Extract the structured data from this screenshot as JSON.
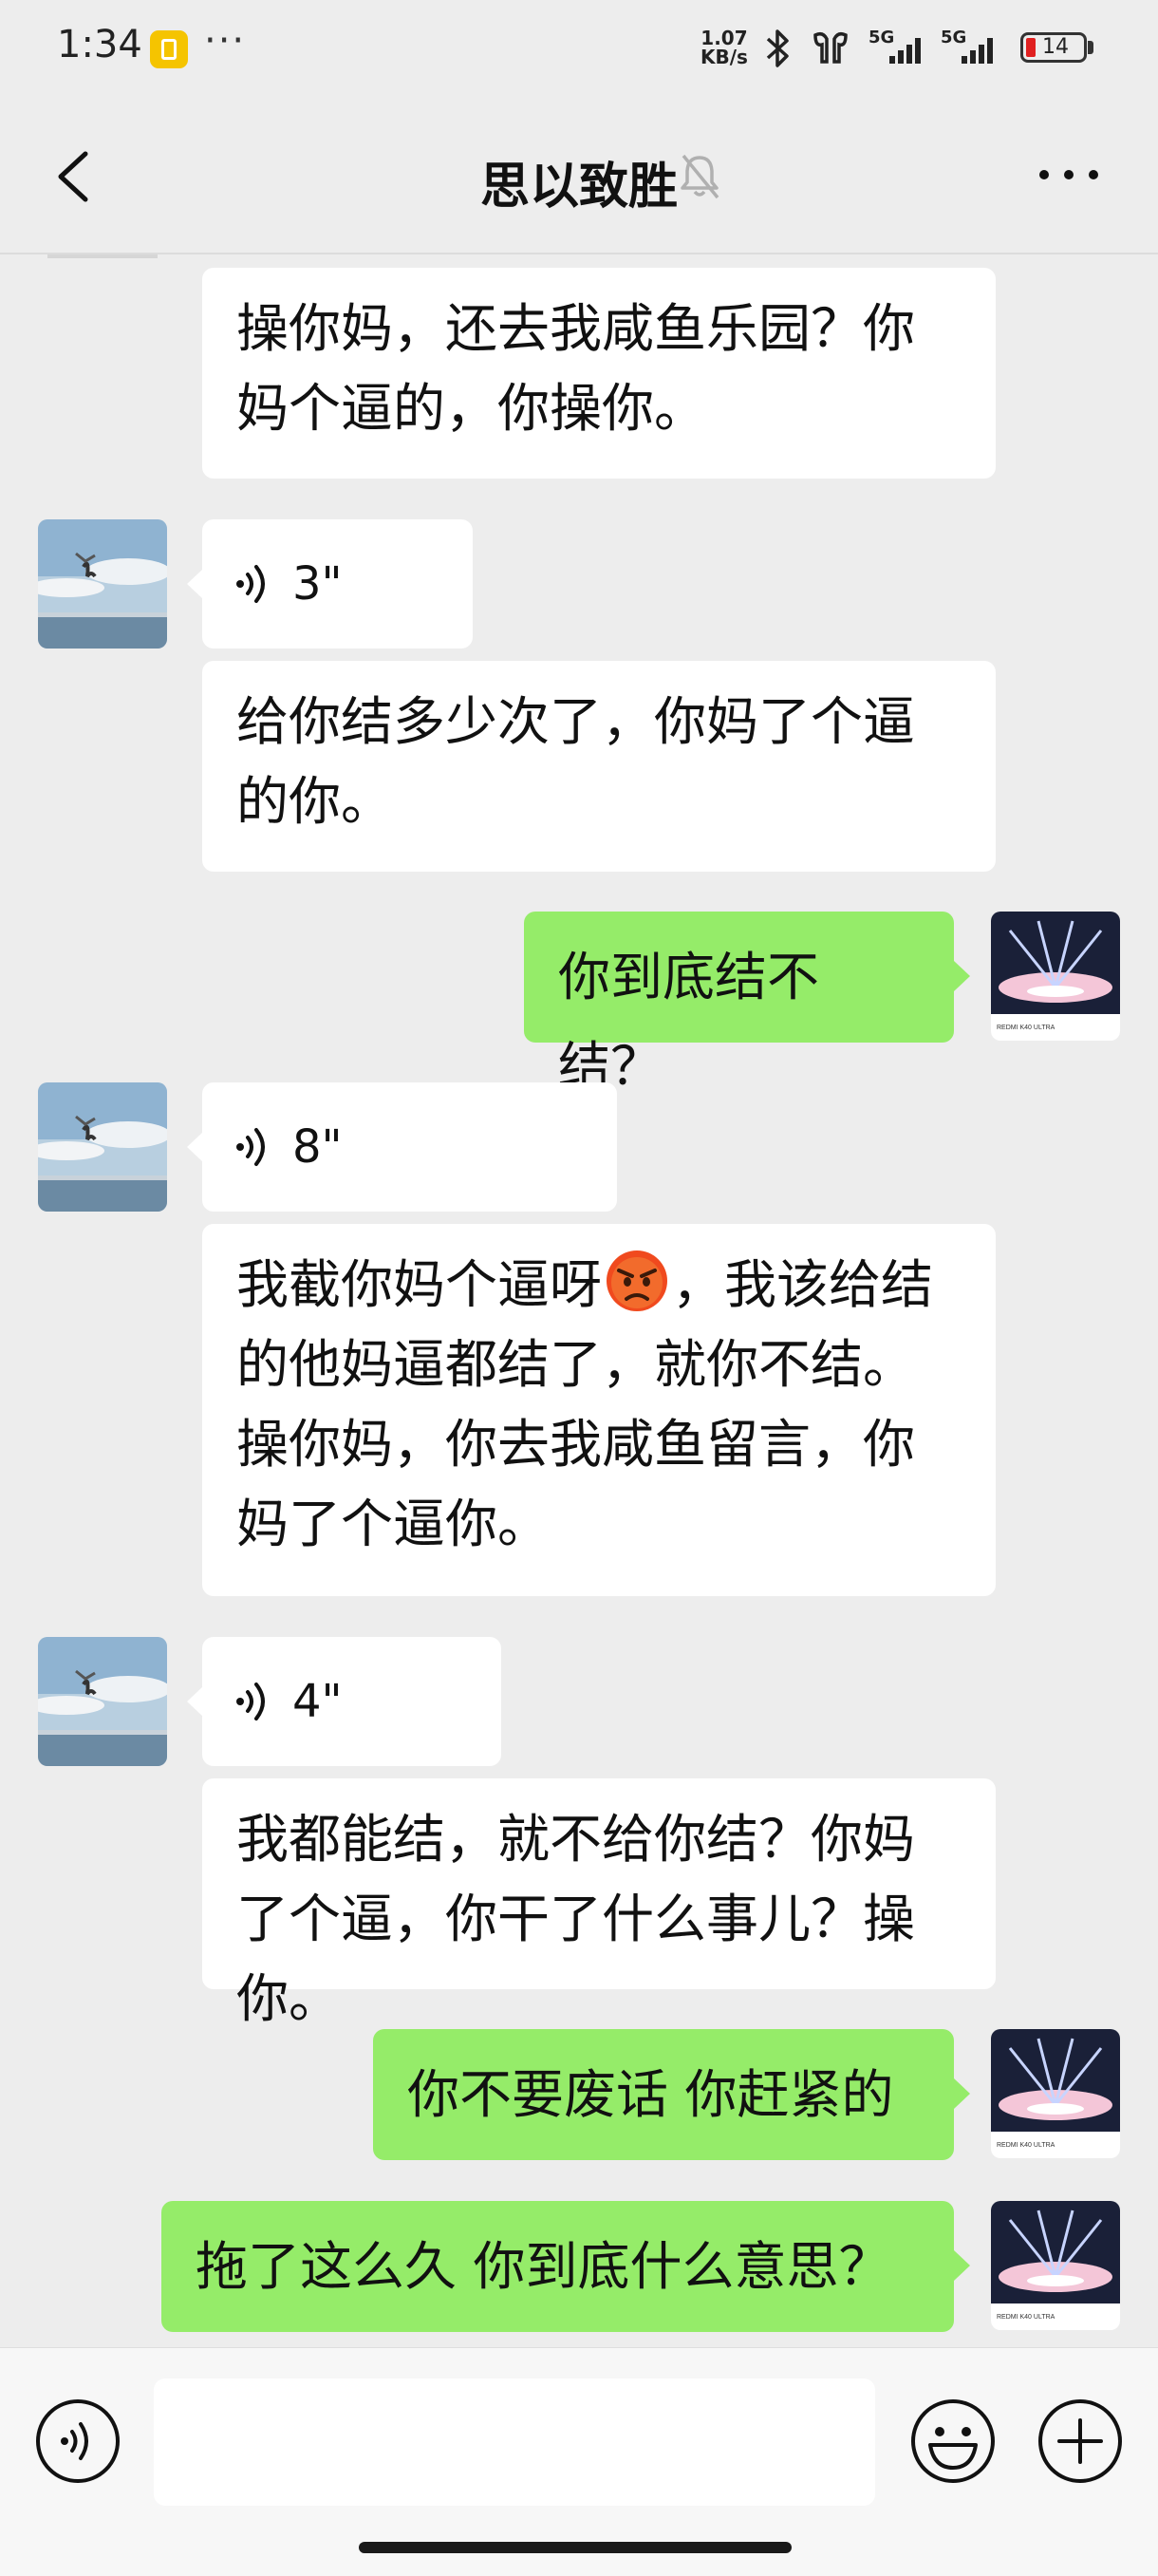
{
  "status_bar": {
    "time": "1:34",
    "dots": "···",
    "net_speed_value": "1.07",
    "net_speed_unit": "KB/s",
    "signal_1_label": "5G",
    "signal_2_label": "5G",
    "battery_level": "14"
  },
  "nav": {
    "title": "思以致胜",
    "muted": true
  },
  "messages": [
    {
      "from": "other",
      "type": "text",
      "text": "操你妈，还去我咸鱼乐园？你妈个逼的，你操你。"
    },
    {
      "from": "other",
      "type": "voice",
      "duration": "3\""
    },
    {
      "from": "other",
      "type": "text",
      "text": "给你结多少次了，你妈了个逼的你。"
    },
    {
      "from": "me",
      "type": "text",
      "text": "你到底结不结？"
    },
    {
      "from": "other",
      "type": "voice",
      "duration": "8\""
    },
    {
      "from": "other",
      "type": "text",
      "text_before_emoji": "我截你妈个逼呀",
      "emoji": "pouting-face",
      "text_after_emoji": "，我该给结的他妈逼都结了，就你不结。操你妈，你去我咸鱼留言，你妈了个逼你。"
    },
    {
      "from": "other",
      "type": "voice",
      "duration": "4\""
    },
    {
      "from": "other",
      "type": "text",
      "text": "我都能结，就不给你结？你妈了个逼，你干了什么事儿？操你。"
    },
    {
      "from": "me",
      "type": "text",
      "text": "你不要废话 你赶紧的"
    },
    {
      "from": "me",
      "type": "text",
      "text": "拖了这么久 你到底什么意思？"
    }
  ],
  "avatar_other_caption": "",
  "avatar_me_caption": "REDMI K40 ULTRA",
  "input": {
    "value": "",
    "placeholder": ""
  },
  "colors": {
    "background": "#ededed",
    "bubble_in": "#ffffff",
    "bubble_out": "#95ec69"
  }
}
